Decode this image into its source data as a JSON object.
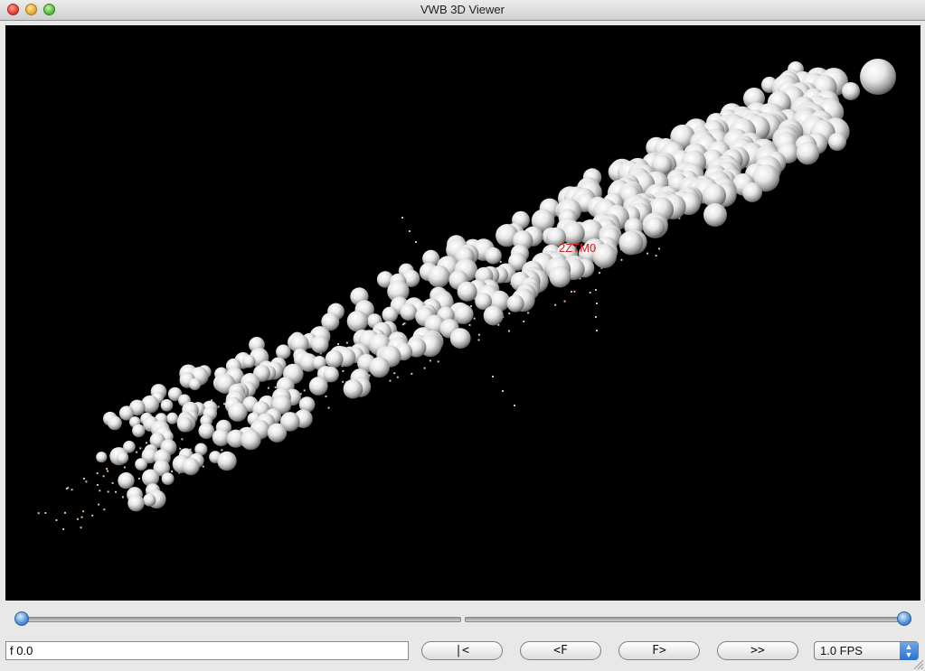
{
  "window": {
    "title": "VWB 3D Viewer"
  },
  "viewport": {
    "background": "#000000",
    "label": "2ZTM0",
    "label_color": "#cc2222"
  },
  "timeline": {
    "start_value": 0.0,
    "end_value": 1.0
  },
  "command": {
    "value": "f 0.0"
  },
  "buttons": {
    "first": "|<",
    "prev_frame": "<F",
    "next_frame": "F>",
    "play": ">>"
  },
  "fps": {
    "selected": "1.0 FPS"
  }
}
